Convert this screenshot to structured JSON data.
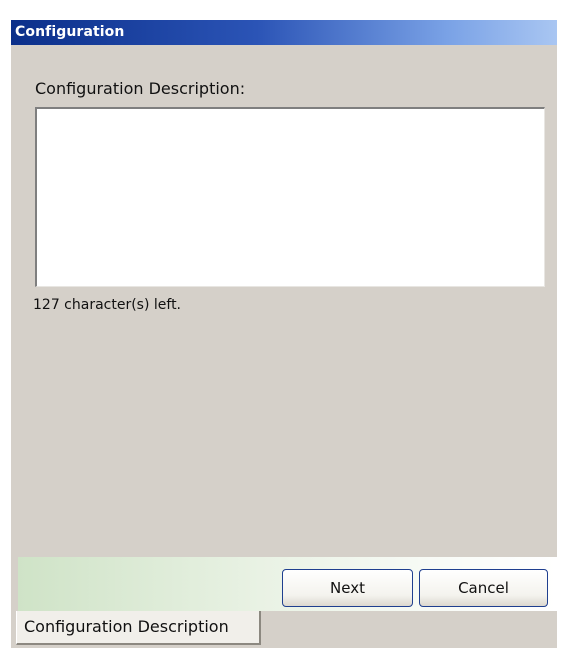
{
  "window": {
    "title": "Configuration"
  },
  "form": {
    "label": "Configuration Description:",
    "description_value": "",
    "chars_left_text": "127 character(s) left."
  },
  "buttons": {
    "next_label": "Next",
    "cancel_label": "Cancel"
  },
  "tabs": [
    {
      "label": "Configuration Description",
      "active": true
    }
  ],
  "colors": {
    "titlebar_start": "#0b2f8a",
    "titlebar_end": "#a9c6f2",
    "panel_background": "#d5d0c9",
    "button_border": "#1f3f8f"
  }
}
